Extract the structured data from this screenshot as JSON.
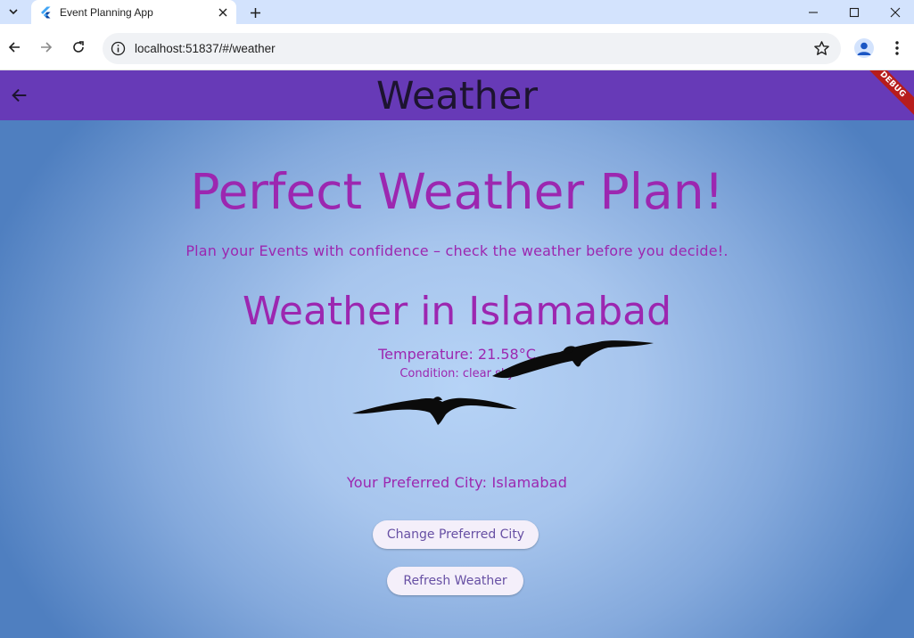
{
  "browser": {
    "tab_title": "Event Planning App",
    "url": "localhost:51837/#/weather",
    "icons": {
      "tab_list": "chevron-down-icon",
      "favicon": "flutter-icon",
      "tab_close": "close-icon",
      "new_tab": "plus-icon",
      "minimize": "minimize-icon",
      "maximize": "maximize-icon",
      "close_window": "close-icon",
      "back": "arrow-left-icon",
      "forward": "arrow-right-icon",
      "reload": "reload-icon",
      "site_info": "info-icon",
      "bookmark": "star-icon",
      "profile": "person-icon",
      "menu": "more-vert-icon"
    }
  },
  "appbar": {
    "title": "Weather",
    "debug_banner": "DEBUG",
    "back_icon": "arrow-back-icon",
    "color": "#673ab7"
  },
  "main": {
    "headline": "Perfect Weather Plan!",
    "tagline": "Plan your Events with confidence – check the weather before you decide!.",
    "city_heading": "Weather in Islamabad",
    "temperature": "Temperature: 21.58°C",
    "condition": "Condition: clear sky",
    "preferred_city": "Your Preferred City: Islamabad",
    "text_color": "#9c27b0",
    "background_image": "birds-in-sky"
  },
  "buttons": {
    "change_city": "Change Preferred City",
    "refresh": "Refresh Weather"
  }
}
